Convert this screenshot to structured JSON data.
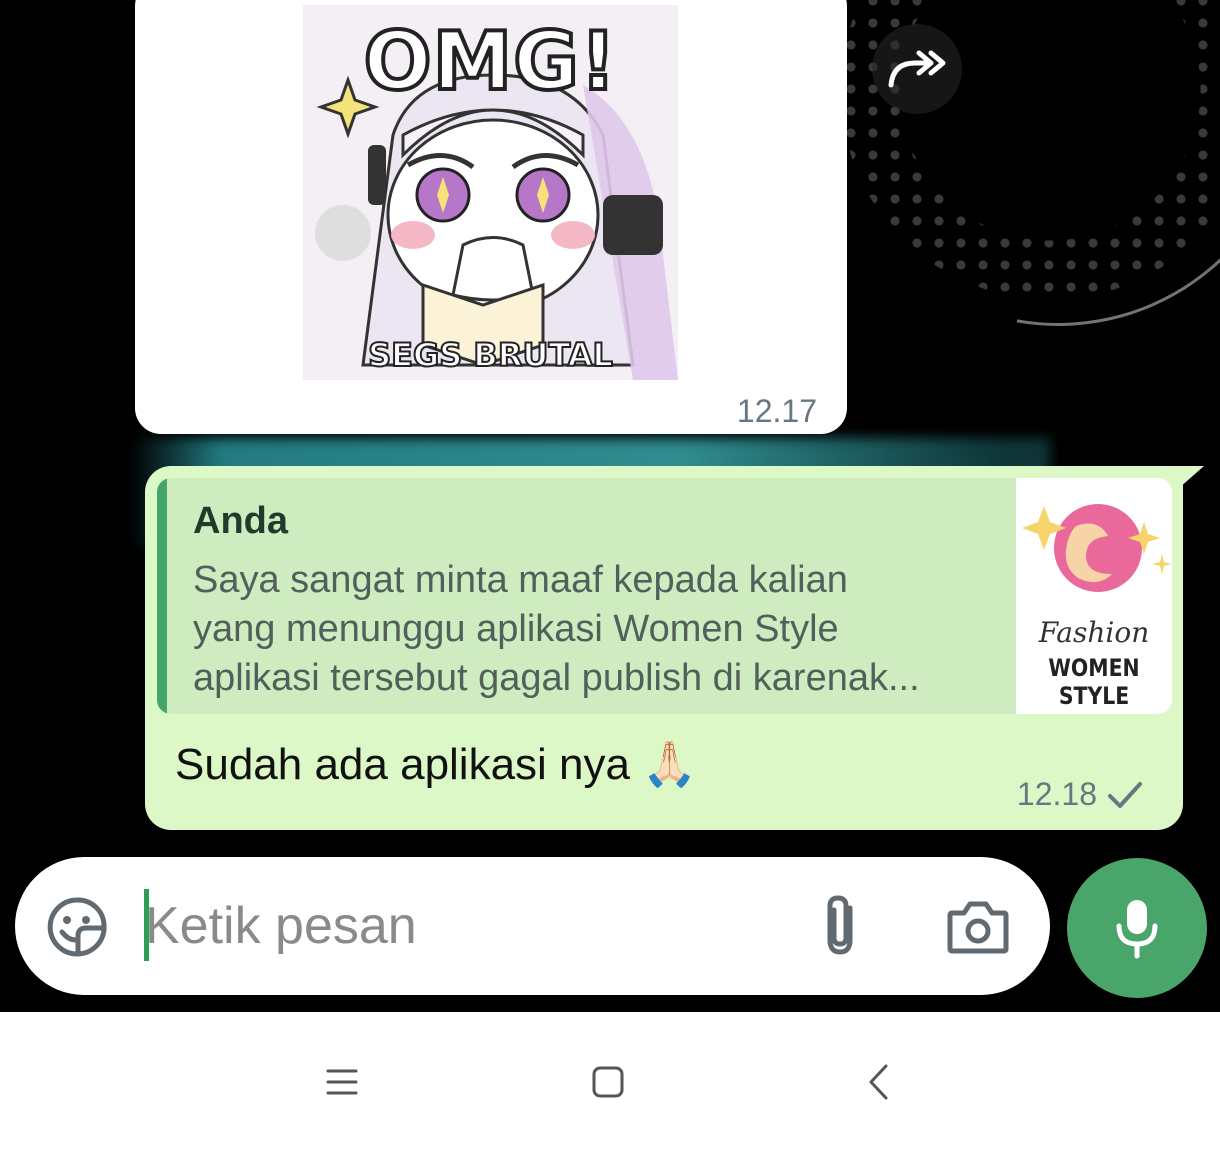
{
  "chat": {
    "incoming_sticker": {
      "top_caption": "OMG!",
      "bottom_caption": "SEGS BRUTAL",
      "time": "12.17"
    },
    "outgoing_message": {
      "quote": {
        "author": "Anda",
        "lines": [
          "Saya sangat minta maaf kepada kalian",
          "yang menunggu aplikasi Women Style",
          "aplikasi tersebut gagal publish di karenak..."
        ],
        "thumbnail": {
          "script_text": "Fashion",
          "brand_text": "WOMEN STYLE"
        }
      },
      "text": "Sudah ada aplikasi nya 🙏🏻",
      "time": "12.18",
      "status_icon": "single-check-icon"
    }
  },
  "composer": {
    "placeholder": "Ketik pesan",
    "value": "",
    "icons": [
      "sticker-icon",
      "attach-icon",
      "camera-icon",
      "mic-icon"
    ]
  },
  "colors": {
    "outgoing_bubble": "#dcf8c6",
    "quote_bar": "#45a56b",
    "mic_button": "#4aa56a",
    "chat_background": "#000000"
  },
  "system_nav": {
    "buttons": [
      "menu-icon",
      "home-icon",
      "back-icon"
    ]
  }
}
